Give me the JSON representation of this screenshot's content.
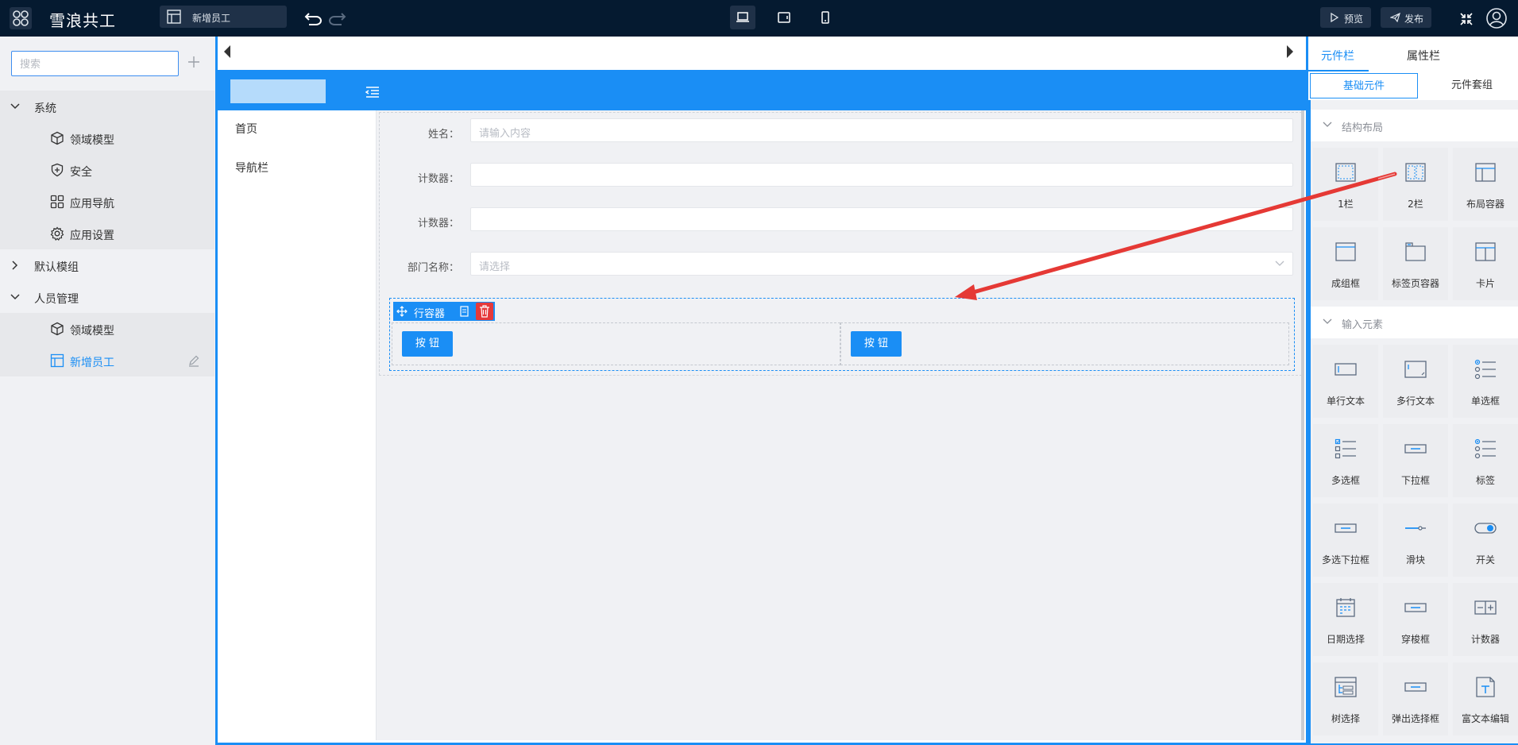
{
  "colors": {
    "accent": "#1a8ef5",
    "topbar": "#051a30",
    "danger": "#e5393a",
    "arrow": "#e53935"
  },
  "topbar": {
    "brand": "雪浪共工",
    "page_tab": "新增员工",
    "preview_label": "预览",
    "publish_label": "发布",
    "devices": [
      "desktop-icon",
      "tablet-icon",
      "mobile-icon"
    ]
  },
  "leftpanel": {
    "search_placeholder": "搜索",
    "groups": [
      {
        "label": "系统",
        "items": [
          "领域模型",
          "安全",
          "应用导航",
          "应用设置"
        ]
      },
      {
        "label": "默认模组",
        "items": []
      },
      {
        "label": "人员管理",
        "items": [
          "领域模型",
          "新增员工"
        ],
        "selected": "新增员工"
      }
    ]
  },
  "app": {
    "nav": [
      "首页",
      "导航栏"
    ],
    "form": [
      {
        "label": "姓名：",
        "placeholder": "请输入内容"
      },
      {
        "label": "计数器：",
        "placeholder": ""
      },
      {
        "label": "计数器：",
        "placeholder": ""
      },
      {
        "label": "部门名称：",
        "placeholder": "请选择"
      }
    ],
    "row_container": {
      "title": "行容器",
      "buttons": [
        "按 钮",
        "按 钮"
      ]
    }
  },
  "rightpanel": {
    "tabs": [
      "元件栏",
      "属性栏"
    ],
    "subtabs": [
      "基础元件",
      "元件套组"
    ],
    "sections": [
      {
        "title": "结构布局",
        "items": [
          "1栏",
          "2栏",
          "布局容器",
          "成组框",
          "标签页容器",
          "卡片"
        ]
      },
      {
        "title": "输入元素",
        "items": [
          "单行文本",
          "多行文本",
          "单选框",
          "多选框",
          "下拉框",
          "标签",
          "多选下拉框",
          "滑块",
          "开关",
          "日期选择",
          "穿梭框",
          "计数器",
          "树选择",
          "弹出选择框",
          "富文本编辑"
        ]
      }
    ]
  }
}
